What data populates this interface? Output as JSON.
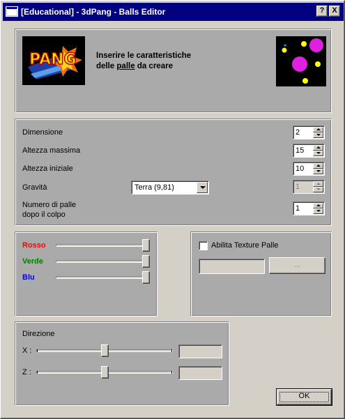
{
  "window": {
    "title": "[Educational] - 3dPang - Balls Editor",
    "help_button": "?",
    "close_button": "X"
  },
  "header": {
    "logo_text": "PANG",
    "description_line1": "Inserire le caratteristiche",
    "description_prefix": "delle ",
    "description_underlined": "palle",
    "description_suffix": " da creare"
  },
  "properties": {
    "dimensione": {
      "label": "Dimensione",
      "value": "2"
    },
    "altezza_massima": {
      "label": "Altezza massima",
      "value": "15"
    },
    "altezza_iniziale": {
      "label": "Altezza iniziale",
      "value": "10"
    },
    "gravita": {
      "label": "Gravità",
      "selected": "Terra (9,81)",
      "custom_value": "1"
    },
    "numero_palle": {
      "label_line1": "Numero di palle",
      "label_line2": "dopo il colpo",
      "value": "1"
    }
  },
  "colors": {
    "rosso": {
      "label": "Rosso",
      "color": "#ff0000",
      "level": 1.0
    },
    "verde": {
      "label": "Verde",
      "color": "#008000",
      "level": 1.0
    },
    "blu": {
      "label": "Blu",
      "color": "#0000ff",
      "level": 1.0
    }
  },
  "texture": {
    "checkbox_label": "Abilita Texture Palle",
    "checked": false,
    "path_value": "",
    "browse_label": "..."
  },
  "direction": {
    "group_label": "Direzione",
    "x": {
      "label": "X :",
      "level": 0.5,
      "value": ""
    },
    "z": {
      "label": "Z :",
      "level": 0.5,
      "value": ""
    }
  },
  "footer": {
    "ok_label": "OK"
  },
  "theme": {
    "titlebar": "#000080",
    "panel": "#aaaaaa",
    "face": "#d4d0c8"
  }
}
